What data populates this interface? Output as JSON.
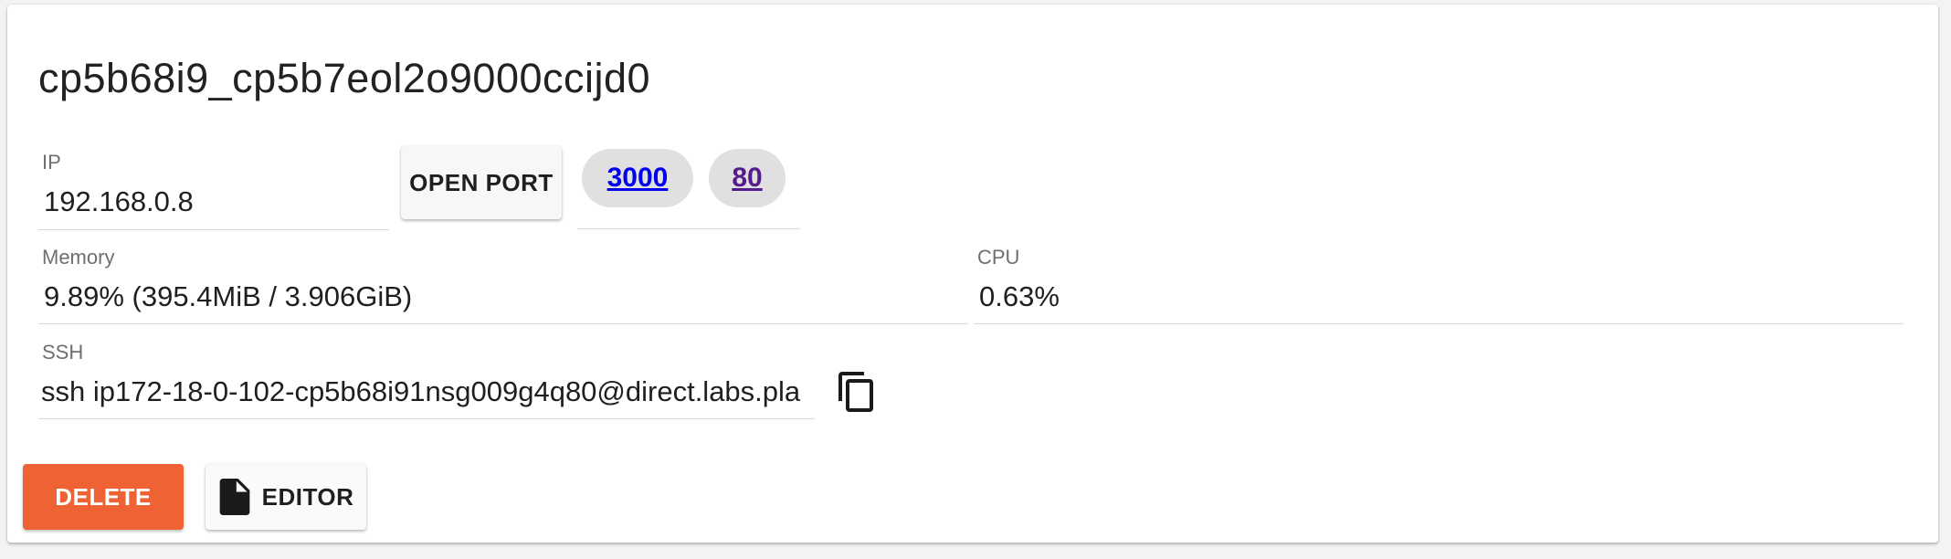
{
  "session": {
    "title": "cp5b68i9_cp5b7eol2o9000ccijd0"
  },
  "ip_field": {
    "label": "IP",
    "value": "192.168.0.8"
  },
  "open_port_button": {
    "label": "OPEN PORT"
  },
  "ports": [
    {
      "label": "3000",
      "color": "#0000ee"
    },
    {
      "label": "80",
      "color": "#551a8b"
    }
  ],
  "memory_field": {
    "label": "Memory",
    "value": "9.89% (395.4MiB / 3.906GiB)"
  },
  "cpu_field": {
    "label": "CPU",
    "value": "0.63%"
  },
  "ssh_field": {
    "label": "SSH",
    "value": "ssh ip172-18-0-102-cp5b68i91nsg009g4q80@direct.labs.pla"
  },
  "copy_icon": "copy-icon",
  "actions": {
    "delete_label": "DELETE",
    "editor_label": "EDITOR",
    "delete_color": "#ef6233"
  }
}
